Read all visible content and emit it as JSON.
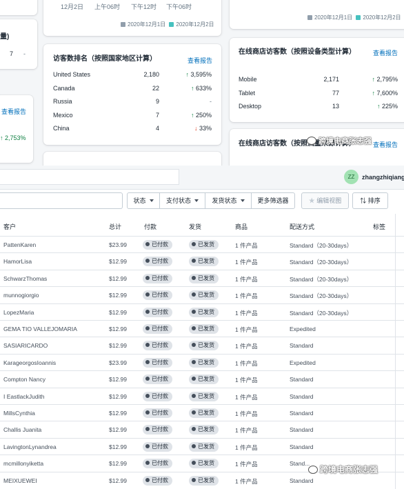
{
  "top_left_card": {
    "x_labels": [
      "12月2日",
      "上午06时",
      "下午12时",
      "下午06时"
    ],
    "legend": [
      "2020年12月1日",
      "2020年12月2日"
    ]
  },
  "top_right_card": {
    "legend": [
      "2020年12月1日",
      "2020年12月2日"
    ]
  },
  "left_partial_card": {
    "title_fragment": "量)",
    "value": "7",
    "dash": "-"
  },
  "left_partial_card2": {
    "link": "查看报告",
    "change": "2,753%"
  },
  "country_card": {
    "title": "访客数排名（按照国家地区计算）",
    "link": "查看报告",
    "rows": [
      {
        "name": "United States",
        "value": "2,180",
        "change": "3,595%",
        "dir": "up"
      },
      {
        "name": "Canada",
        "value": "22",
        "change": "633%",
        "dir": "up"
      },
      {
        "name": "Russia",
        "value": "9",
        "change": "-",
        "dir": "none"
      },
      {
        "name": "Mexico",
        "value": "7",
        "change": "250%",
        "dir": "up"
      },
      {
        "name": "China",
        "value": "4",
        "change": "33%",
        "dir": "down"
      }
    ]
  },
  "device_card": {
    "title": "在线商店访客数（按照设备类型计算）",
    "link": "查看报告",
    "rows": [
      {
        "name": "Mobile",
        "value": "2,171",
        "change": "2,795%",
        "dir": "up"
      },
      {
        "name": "Tablet",
        "value": "77",
        "change": "7,600%",
        "dir": "up"
      },
      {
        "name": "Desktop",
        "value": "13",
        "change": "225%",
        "dir": "up"
      }
    ]
  },
  "source_card": {
    "title": "在线商店访客数（按照流量来源计算）",
    "link": "查看报告"
  },
  "watermark": "跨境电商张志强",
  "topbar": {
    "avatar_initials": "ZZ",
    "username": "zhangzhiqiang"
  },
  "filters": {
    "status": "状态",
    "payment_status": "支付状态",
    "shipping_status": "发货状态",
    "more_filters": "更多筛选器",
    "save_view": "编辑视图",
    "sort": "排序"
  },
  "table": {
    "headers": {
      "customer": "客户",
      "total": "总计",
      "payment": "付款",
      "fulfillment": "发货",
      "items": "商品",
      "delivery": "配送方式",
      "tags": "标签"
    },
    "rows": [
      {
        "customer": "PattenKaren",
        "total": "$23.99",
        "payment": "已付款",
        "fulfillment": "已发货",
        "items": "1 件产品",
        "delivery": "Standard（20-30days）"
      },
      {
        "customer": "HamorLisa",
        "total": "$12.99",
        "payment": "已付款",
        "fulfillment": "已发货",
        "items": "1 件产品",
        "delivery": "Standard（20-30days）"
      },
      {
        "customer": "SchwarzThomas",
        "total": "$12.99",
        "payment": "已付款",
        "fulfillment": "已发货",
        "items": "1 件产品",
        "delivery": "Standard（20-30days）"
      },
      {
        "customer": "munnogiorgio",
        "total": "$12.99",
        "payment": "已付款",
        "fulfillment": "已发货",
        "items": "1 件产品",
        "delivery": "Standard（20-30days）"
      },
      {
        "customer": "LopezMaria",
        "total": "$12.99",
        "payment": "已付款",
        "fulfillment": "已发货",
        "items": "1 件产品",
        "delivery": "Standard（20-30days）"
      },
      {
        "customer": "GEMA TIO VALLEJOMARIA",
        "total": "$12.99",
        "payment": "已付款",
        "fulfillment": "已发货",
        "items": "1 件产品",
        "delivery": "Expedited"
      },
      {
        "customer": "SASIARICARDO",
        "total": "$12.99",
        "payment": "已付款",
        "fulfillment": "已发货",
        "items": "1 件产品",
        "delivery": "Standard"
      },
      {
        "customer": "KarageorgosIoannis",
        "total": "$23.99",
        "payment": "已付款",
        "fulfillment": "已发货",
        "items": "1 件产品",
        "delivery": "Expedited"
      },
      {
        "customer": "Compton Nancy",
        "total": "$12.99",
        "payment": "已付款",
        "fulfillment": "已发货",
        "items": "1 件产品",
        "delivery": "Standard"
      },
      {
        "customer": "I EastlackJudith",
        "total": "$12.99",
        "payment": "已付款",
        "fulfillment": "已发货",
        "items": "1 件产品",
        "delivery": "Standard"
      },
      {
        "customer": "MillsCynthia",
        "total": "$12.99",
        "payment": "已付款",
        "fulfillment": "已发货",
        "items": "1 件产品",
        "delivery": "Standard"
      },
      {
        "customer": "Challis Juanita",
        "total": "$12.99",
        "payment": "已付款",
        "fulfillment": "已发货",
        "items": "1 件产品",
        "delivery": "Standard"
      },
      {
        "customer": "LavingtonLynandrea",
        "total": "$12.99",
        "payment": "已付款",
        "fulfillment": "已发货",
        "items": "1 件产品",
        "delivery": "Standard"
      },
      {
        "customer": "mcmillonyiketta",
        "total": "$12.99",
        "payment": "已付款",
        "fulfillment": "已发货",
        "items": "1 件产品",
        "delivery": "Stand..."
      },
      {
        "customer": "MEIXUEWEI",
        "total": "$12.99",
        "payment": "已付款",
        "fulfillment": "已发货",
        "items": "1 件产品",
        "delivery": "Standard"
      }
    ]
  },
  "colors": {
    "accent": "#006fbb",
    "up": "#108043",
    "down": "#de3618",
    "legend_a": "#919eab",
    "legend_b": "#47c1bf"
  }
}
